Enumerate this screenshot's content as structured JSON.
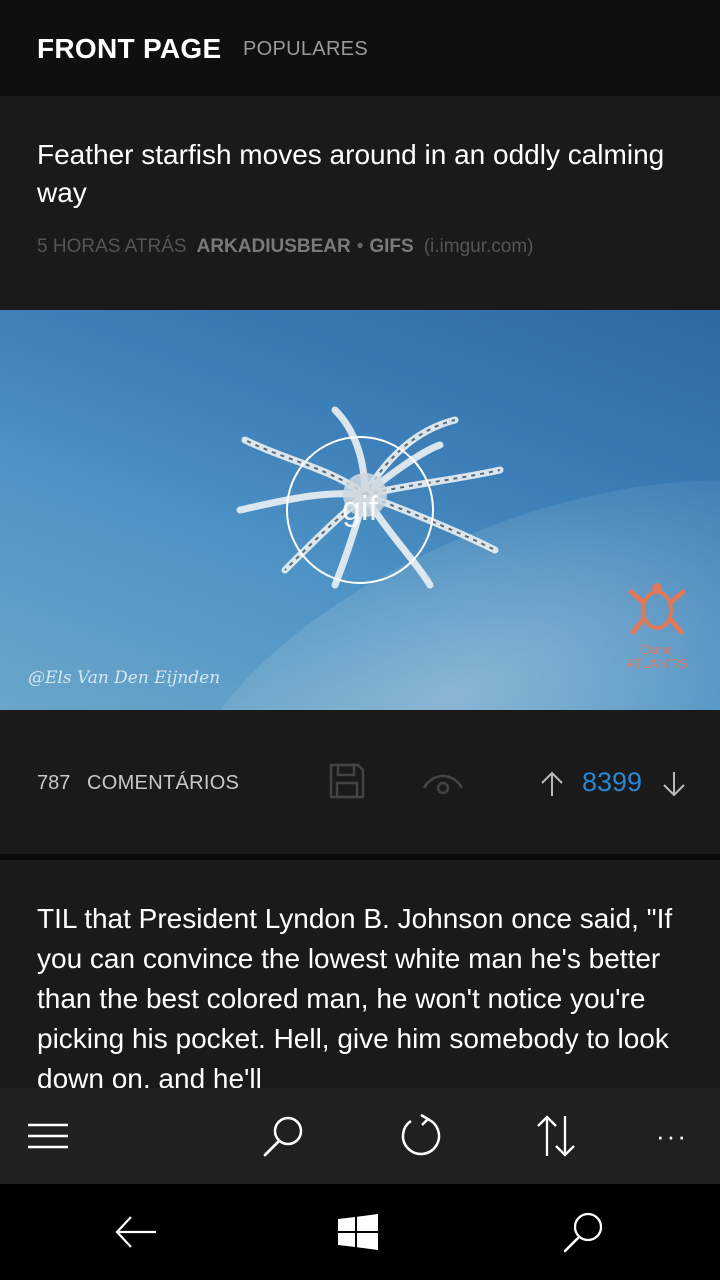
{
  "header": {
    "pivot_active": "FRONT PAGE",
    "pivot_inactive": "POPULARES"
  },
  "post1": {
    "title": "Feather starfish moves around in an oddly calming way",
    "time": "5 HORAS ATRÁS",
    "author": "ARKADIUSBEAR",
    "separator": "•",
    "subreddit": "GIFS",
    "domain": "(i.imgur.com)",
    "media_badge": "gif",
    "watermark": "@Els Van Den Eijnden",
    "logo_line1": "Dune",
    "logo_line2": "ATLANTIS",
    "comments_count": "787",
    "comments_label": "COMENTÁRIOS",
    "score": "8399"
  },
  "post2": {
    "title": "TIL that President Lyndon B. Johnson once said, \"If you can convince the lowest white man he's better than the best colored man, he won't notice you're picking his pocket. Hell, give him somebody to look down on, and he'll"
  },
  "appbar": {
    "icons": [
      "hamburger-menu-icon",
      "search-icon",
      "refresh-icon",
      "sort-icon",
      "more-icon"
    ],
    "more_label": "···"
  },
  "sysnav": {
    "icons": [
      "back-icon",
      "windows-start-icon",
      "search-icon"
    ]
  },
  "colors": {
    "accent": "#2b86d6",
    "background": "#1a1a1a",
    "header": "#0f0f0f",
    "appbar": "#202020"
  }
}
